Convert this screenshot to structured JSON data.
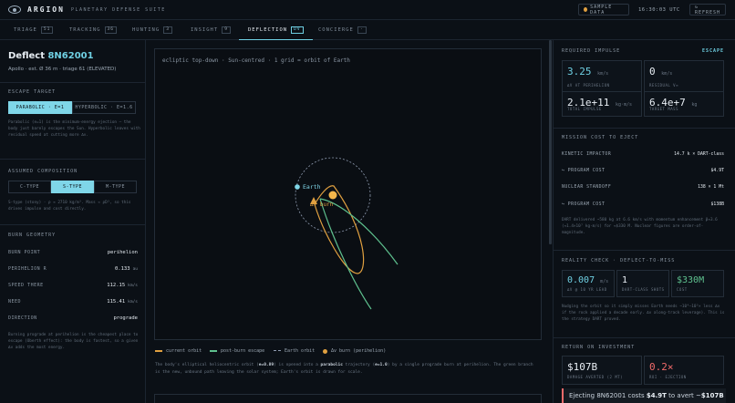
{
  "header": {
    "brand": "ARGION",
    "suite": "PLANETARY DEFENSE SUITE",
    "sample_label": "SAMPLE DATA",
    "clock": "16:30:03 UTC",
    "refresh_label": "↻ REFRESH"
  },
  "tabs": [
    {
      "label": "TRIAGE",
      "badge": "51"
    },
    {
      "label": "TRACKING",
      "badge": "36"
    },
    {
      "label": "HUNTING",
      "badge": "3"
    },
    {
      "label": "INSIGHT",
      "badge": "9"
    },
    {
      "label": "DEFLECTION",
      "badge": "DV"
    },
    {
      "label": "CONCIERGE",
      "badge": "·"
    }
  ],
  "left": {
    "title_prefix": "Deflect ",
    "title_id": "8N62001",
    "subtitle": "Apollo · est. Ø 36 m · triage 61 (ELEVATED)",
    "escape_label": "ESCAPE TARGET",
    "escape_options": [
      "PARABOLIC · E=1",
      "HYPERBOLIC · E=1.6"
    ],
    "escape_note": "Parabolic (e=1) is the minimum-energy ejection — the body just barely escapes the Sun. Hyperbolic leaves with residual speed at cutting more Δv.",
    "comp_label": "ASSUMED COMPOSITION",
    "comp_options": [
      "C-TYPE",
      "S-TYPE",
      "M-TYPE"
    ],
    "comp_note": "S-type (stony) · ρ ≈ 2710 kg/m³. Mass ∝ ρD³, so this drives impulse and cost directly.",
    "burn_label": "BURN GEOMETRY",
    "burn_rows": [
      {
        "k": "BURN POINT",
        "v": "perihelion",
        "u": ""
      },
      {
        "k": "PERIHELION R",
        "v": "0.133",
        "u": "au"
      },
      {
        "k": "SPEED THERE",
        "v": "112.15",
        "u": "km/s"
      },
      {
        "k": "NEED",
        "v": "115.41",
        "u": "km/s"
      },
      {
        "k": "DIRECTION",
        "v": "prograde",
        "u": ""
      }
    ],
    "burn_note": "Burning prograde at perihelion is the cheapest place to escape (Oberth effect): the body is fastest, so a given Δv adds the most energy."
  },
  "plot": {
    "caption": "ecliptic top-down · Sun-centred · 1 grid = orbit of Earth",
    "earth_label": "Earth",
    "burn_label": "Δv burn",
    "legend": [
      "current orbit",
      "post-burn escape",
      "Earth orbit",
      "Δv burn (perihelion)"
    ],
    "colors": {
      "current": "#e0a040",
      "escape": "#5ec08e",
      "earth": "#7fd6e8",
      "burn": "#e0a040"
    }
  },
  "explain": {
    "t1": "The body's elliptical heliocentric orbit (",
    "b1": "e=0.89",
    "t2": ") is opened into a ",
    "b2": "parabolic",
    "t3": " trajectory (",
    "b3": "e=1.0",
    "t4": ") by a single prograde burn at perihelion. The green branch is the new, unbound path leaving the solar system; Earth's orbit is drawn for scale."
  },
  "right": {
    "impulse_label": "REQUIRED IMPULSE",
    "impulse_mode": "ESCAPE",
    "cards": [
      {
        "v": "3.25",
        "u": "km/s",
        "cap": "ΔV AT PERIHELION"
      },
      {
        "v": "0",
        "u": "km/s",
        "cap": "RESIDUAL V∞"
      },
      {
        "v": "2.1e+11",
        "u": "kg·m/s",
        "cap": "TOTAL IMPULSE"
      },
      {
        "v": "6.4e+7",
        "u": "kg",
        "cap": "TARGET MASS"
      }
    ],
    "mission_label": "MISSION COST TO EJECT",
    "mission_rows": [
      {
        "k": "KINETIC IMPACTOR",
        "v": "14.7 k × DART-class"
      },
      {
        "k": "↪ PROGRAM COST",
        "v": "$4.9T"
      },
      {
        "k": "NUCLEAR STANDOFF",
        "v": "138 × 1 Mt"
      },
      {
        "k": "↪ PROGRAM COST",
        "v": "$138B"
      }
    ],
    "mission_note": "DART delivered ~580 kg at 6.6 km/s with momentum enhancement β≈3.6 (≈1.4×10⁷ kg·m/s) for ≈$330 M. Nuclear figures are order-of-magnitude.",
    "reality_label": "REALITY CHECK · DEFLECT-TO-MISS",
    "reality_cards": [
      {
        "v": "0.007",
        "u": "m/s",
        "cap": "ΔV @ 10 YR LEAD"
      },
      {
        "v": "1",
        "u": "",
        "cap": "DART-CLASS SHOTS"
      },
      {
        "v": "$330M",
        "u": "",
        "cap": "COST"
      }
    ],
    "reality_note": "Nudging the orbit so it simply misses Earth needs ~10⁴–10⁵× less Δv if the rock applied a decade early. Δv along-track leverage). This is the strategy DART proved.",
    "roi_label": "RETURN ON INVESTMENT",
    "roi_cards": [
      {
        "v": "$107B",
        "cap": "DAMAGE AVERTED (2 MT)"
      },
      {
        "v": "0.2×",
        "cap": "ROI · EJECTION"
      }
    ],
    "alert_t1": "Ejecting 8N62001 costs ",
    "alert_b1": "$4.9T",
    "alert_t2": " to avert ~",
    "alert_b2": "$107B",
    "alert_t3": " of"
  }
}
